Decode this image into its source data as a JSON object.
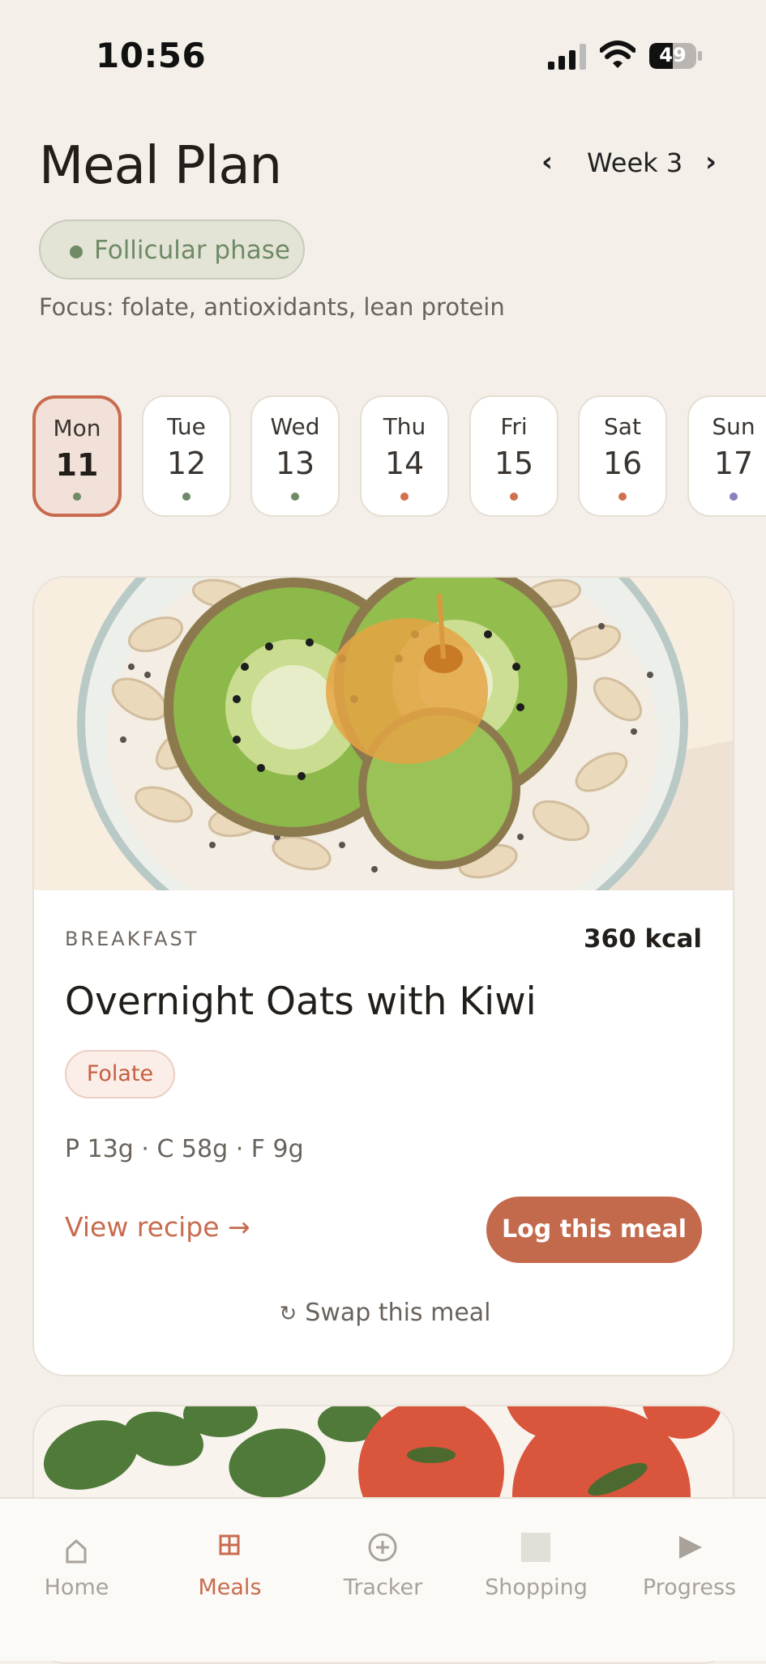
{
  "status_bar": {
    "time": "10:56",
    "battery": "49"
  },
  "header": {
    "title": "Meal Plan",
    "week_prev": "‹",
    "week_label": "Week 3",
    "week_next": "›"
  },
  "phase": {
    "label": "Follicular phase",
    "focus": "Focus: folate, antioxidants, lean protein",
    "color": "#6E8A66"
  },
  "days": [
    {
      "name": "Mon",
      "num": "11",
      "dot": "#6E8A66",
      "selected": true
    },
    {
      "name": "Tue",
      "num": "12",
      "dot": "#6E8A66",
      "selected": false
    },
    {
      "name": "Wed",
      "num": "13",
      "dot": "#6E8A66",
      "selected": false
    },
    {
      "name": "Thu",
      "num": "14",
      "dot": "#D0704F",
      "selected": false
    },
    {
      "name": "Fri",
      "num": "15",
      "dot": "#D0704F",
      "selected": false
    },
    {
      "name": "Sat",
      "num": "16",
      "dot": "#D0704F",
      "selected": false
    },
    {
      "name": "Sun",
      "num": "17",
      "dot": "#8A7FBE",
      "selected": false
    }
  ],
  "meal": {
    "type": "BREAKFAST",
    "kcal": "360 kcal",
    "name": "Overnight Oats with Kiwi",
    "tag": "Folate",
    "macros": "P 13g · C 58g · F 9g",
    "view_recipe": "View recipe →",
    "log_button": "Log this meal",
    "swap_icon": "↻",
    "swap": "Swap this meal"
  },
  "tabs": [
    {
      "label": "Home",
      "icon": "home-icon",
      "active": false
    },
    {
      "label": "Meals",
      "icon": "grid-icon",
      "active": true
    },
    {
      "label": "Tracker",
      "icon": "plus-circle-icon",
      "active": false
    },
    {
      "label": "Shopping",
      "icon": "square-icon",
      "active": false
    },
    {
      "label": "Progress",
      "icon": "play-icon",
      "active": false
    }
  ],
  "colors": {
    "accent": "#C86B4E",
    "background": "#F4F0E9",
    "phase_green": "#6E8A66"
  }
}
